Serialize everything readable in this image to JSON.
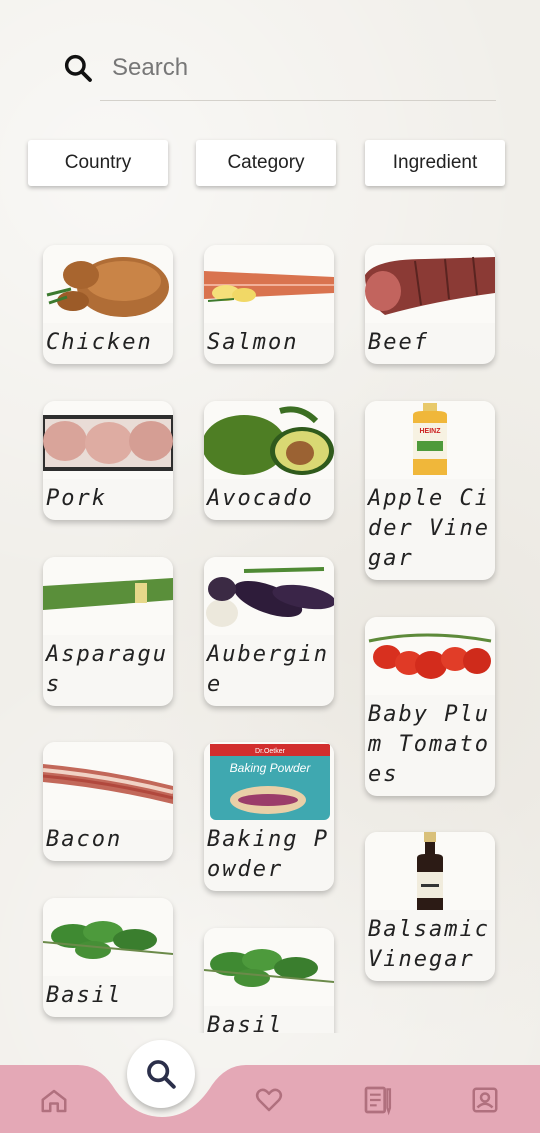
{
  "search": {
    "placeholder": "Search"
  },
  "filters": [
    "Country",
    "Category",
    "Ingredient"
  ],
  "ingredients": [
    {
      "name": "Chicken"
    },
    {
      "name": "Salmon"
    },
    {
      "name": "Beef"
    },
    {
      "name": "Pork"
    },
    {
      "name": "Avocado"
    },
    {
      "name": "Apple Cider Vinegar"
    },
    {
      "name": "Asparagus"
    },
    {
      "name": "Aubergine"
    },
    {
      "name": "Baby Plum Tomatoes"
    },
    {
      "name": "Bacon"
    },
    {
      "name": "Baking Powder"
    },
    {
      "name": "Balsamic Vinegar"
    },
    {
      "name": "Basil"
    },
    {
      "name": "Basil"
    }
  ],
  "product_labels": {
    "heinz": "HEINZ",
    "dr_oetker": "Dr.Oetker",
    "baking_powder": "Baking Powder"
  },
  "bottom_nav": [
    "home-icon",
    "search-icon",
    "heart-icon",
    "recipe-book-icon",
    "profile-icon"
  ],
  "colors": {
    "nav_bar": "#e4a8b6",
    "nav_icon": "#b0707e",
    "background": "#f1efea"
  }
}
